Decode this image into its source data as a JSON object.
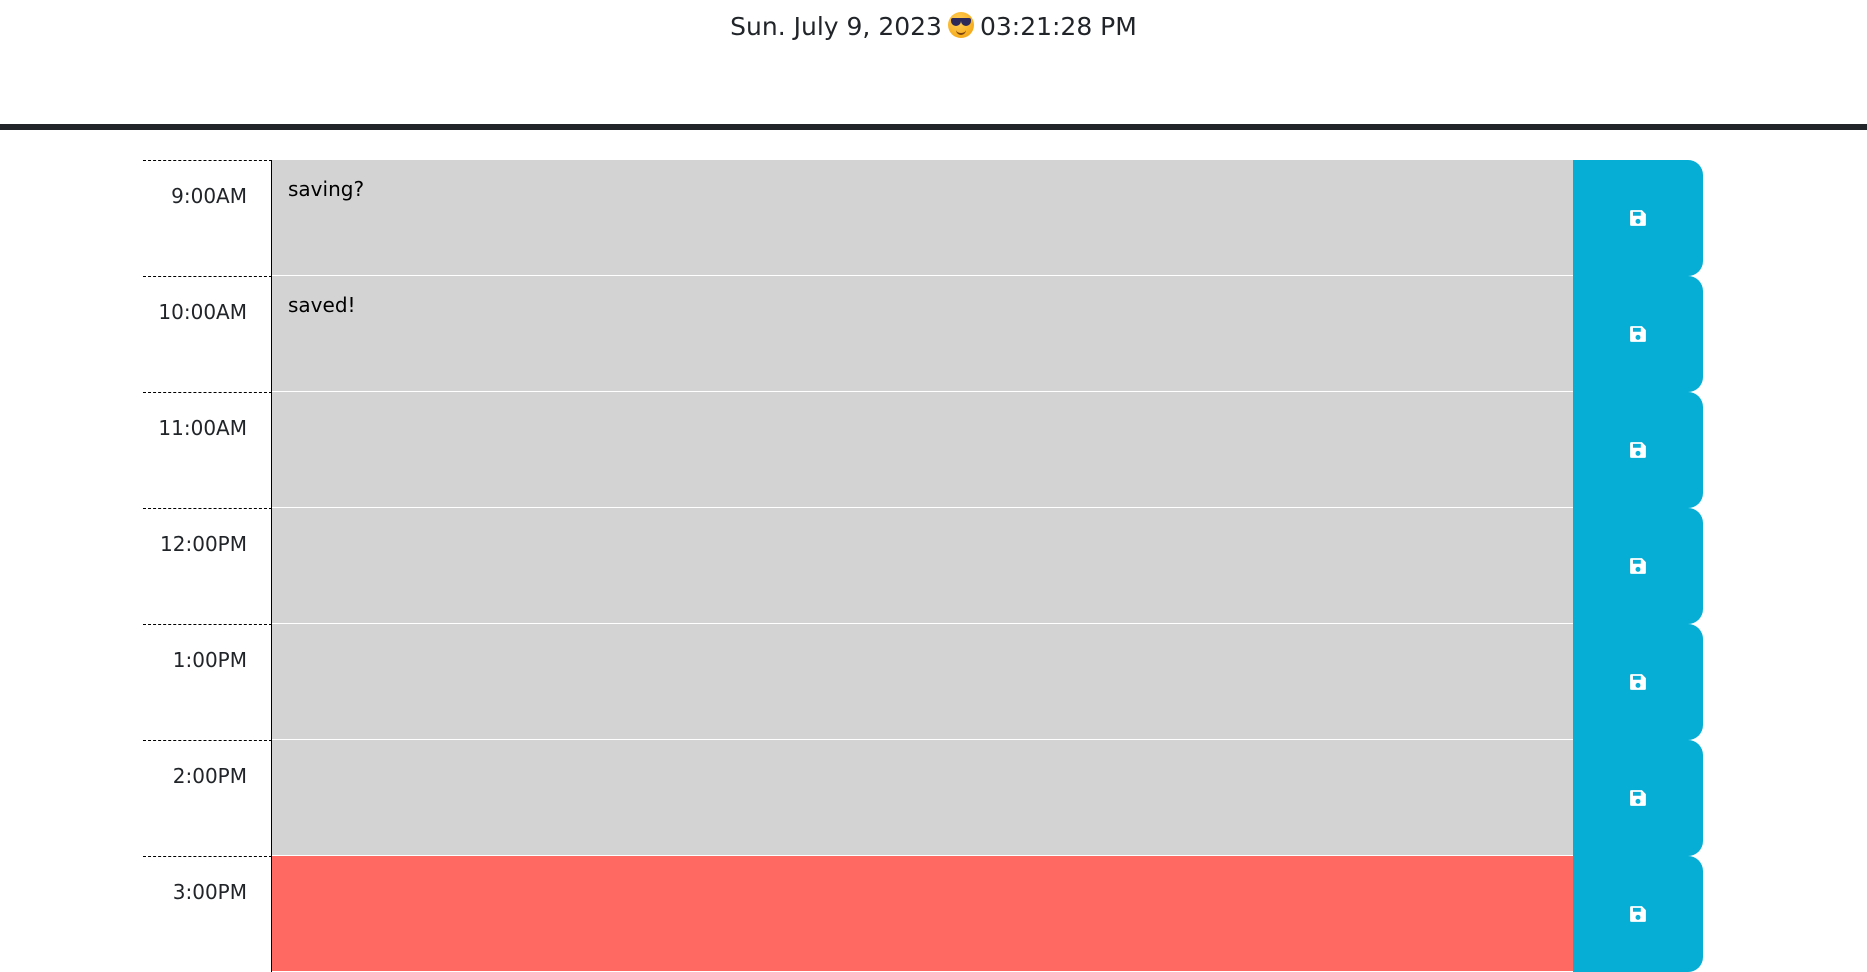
{
  "header": {
    "date_text": "Sun. July 9, 2023",
    "emoji_icon": "smiling-face-with-sunglasses",
    "time_text": "03:21:28 PM"
  },
  "rows": [
    {
      "hour": "9:00AM",
      "text": "saving?",
      "state": "past"
    },
    {
      "hour": "10:00AM",
      "text": "saved!",
      "state": "past"
    },
    {
      "hour": "11:00AM",
      "text": "",
      "state": "past"
    },
    {
      "hour": "12:00PM",
      "text": "",
      "state": "past"
    },
    {
      "hour": "1:00PM",
      "text": "",
      "state": "past"
    },
    {
      "hour": "2:00PM",
      "text": "",
      "state": "past"
    },
    {
      "hour": "3:00PM",
      "text": "",
      "state": "present"
    }
  ],
  "save_icon": "floppy-disk-icon",
  "colors": {
    "past": "#d3d3d3",
    "present": "#ff6961",
    "save_button": "#06aed5",
    "header_rule": "#212529"
  }
}
